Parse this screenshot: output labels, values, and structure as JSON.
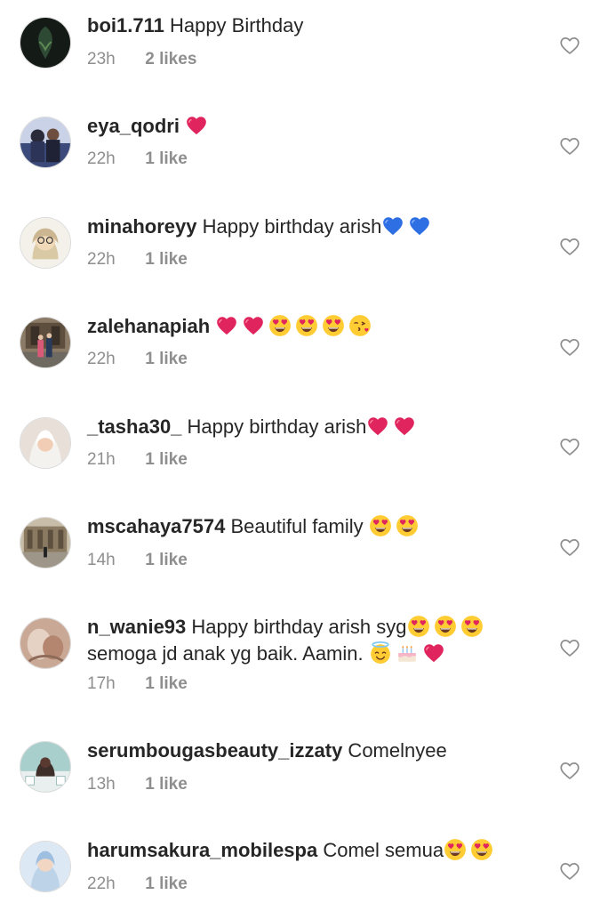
{
  "comments": [
    {
      "username": "boi1.711",
      "text": " Happy Birthday",
      "time": "23h",
      "likes": "2 likes",
      "avatar_color": "#1d2a22"
    },
    {
      "username": "eya_qodri",
      "text": " ",
      "time": "22h",
      "likes": "1 like",
      "avatar_color": "#3b4a7a"
    },
    {
      "username": "minahoreyy",
      "text": " Happy birthday arish",
      "time": "22h",
      "likes": "1 like",
      "avatar_color": "#f3f1ea"
    },
    {
      "username": "zalehanapiah",
      "text": " ",
      "time": "22h",
      "likes": "1 like",
      "avatar_color": "#6e5a4a"
    },
    {
      "username": "_tasha30_",
      "text": " Happy birthday arish",
      "time": "21h",
      "likes": "1 like",
      "avatar_color": "#d9cfc8"
    },
    {
      "username": "mscahaya7574",
      "text": " Beautiful family ",
      "time": "14h",
      "likes": "1 like",
      "avatar_color": "#9a8a72"
    },
    {
      "username": "n_wanie93",
      "text": " Happy birthday arish syg",
      "text2": "semoga jd anak yg baik. Aamin. ",
      "time": "17h",
      "likes": "1 like",
      "avatar_color": "#b89a86"
    },
    {
      "username": "serumbougasbeauty_izzaty",
      "text": " Comelnyee",
      "time": "13h",
      "likes": "1 like",
      "avatar_color": "#7fa8a6"
    },
    {
      "username": "harumsakura_mobilespa",
      "text": " Comel semua",
      "time": "22h",
      "likes": "1 like",
      "avatar_color": "#bcd3e8"
    }
  ],
  "emoji_names": {
    "red_heart": "red-heart-emoji",
    "blue_heart": "blue-heart-emoji",
    "heart_eyes": "heart-eyes-emoji",
    "kiss": "face-blowing-kiss-emoji",
    "halo": "smiling-face-with-halo-emoji",
    "cake": "birthday-cake-emoji"
  },
  "colors": {
    "text": "#262626",
    "secondary": "#8e8e8e",
    "red_heart": "#e0245e",
    "blue_heart": "#2f6fe4"
  }
}
